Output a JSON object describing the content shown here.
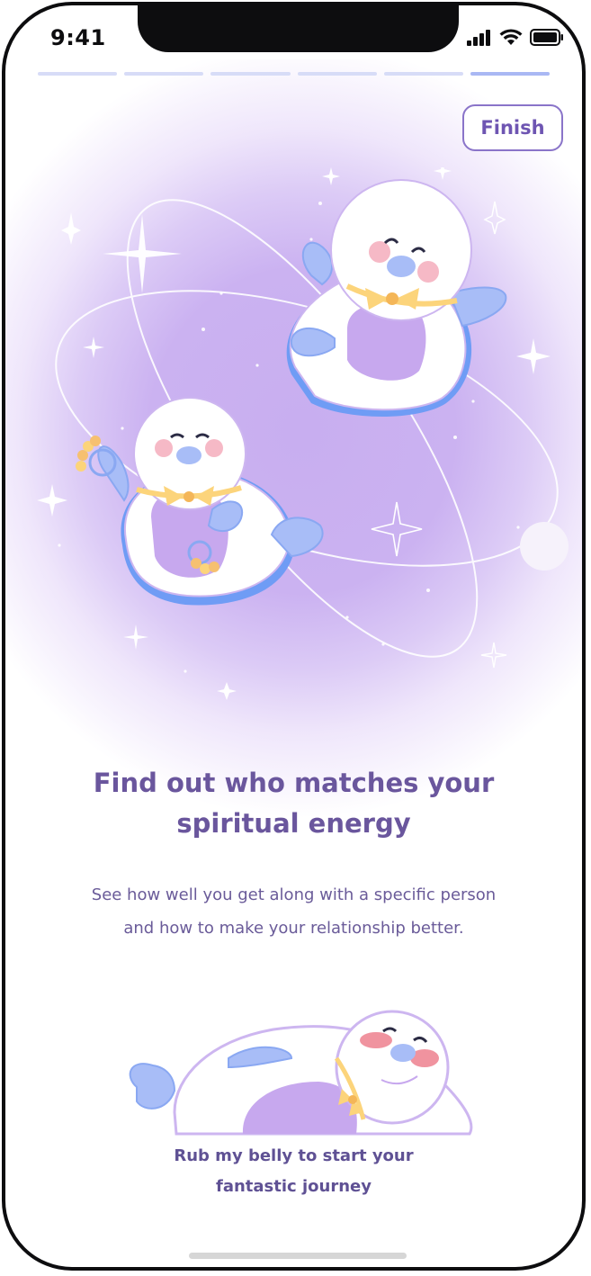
{
  "status_bar": {
    "time": "9:41",
    "icons": [
      "cellular-signal-icon",
      "wifi-icon",
      "battery-icon"
    ]
  },
  "progress": {
    "total_steps": 6,
    "current_step": 6
  },
  "header": {
    "finish_label": "Finish"
  },
  "illustration": {
    "description_icons": [
      "seal-mascot-illustration",
      "sparkle-icon",
      "moon-icon"
    ]
  },
  "content": {
    "headline_line1": "Find out who matches your",
    "headline_line2": "spiritual energy",
    "subtext_line1": "See how well you get along with a specific person",
    "subtext_line2": "and how to make your relationship better."
  },
  "cta": {
    "line1": "Rub my belly to start your",
    "line2": "fantastic journey"
  },
  "colors": {
    "accent": "#6a569d",
    "finish_border": "#8a74c9",
    "hero_bg": "#c8aef0",
    "progress_inactive": "#d7dcf7",
    "progress_active": "#a9b8f4",
    "seal_belly": "#c7a8ee",
    "seal_flipper": "#a8bdf7",
    "bow": "#fcd47b"
  }
}
